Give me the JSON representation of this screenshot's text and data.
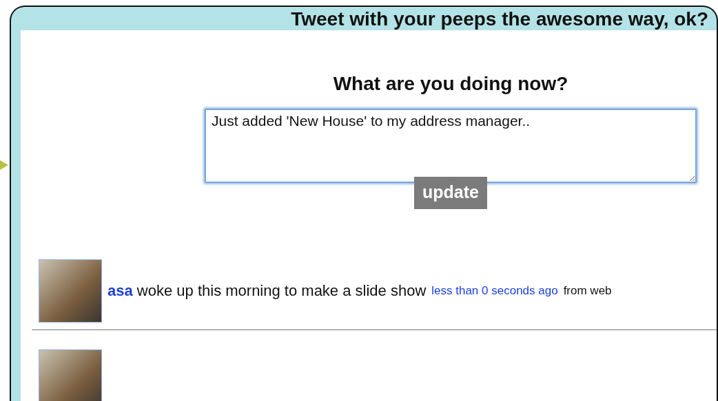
{
  "header": {
    "title": "Tweet with your peeps the awesome way, ok?"
  },
  "composer": {
    "heading": "What are you doing now?",
    "value": "Just added 'New House' to my address manager..",
    "button": "update"
  },
  "tweets": [
    {
      "kind": "full",
      "user": "asa",
      "text": "woke up this morning to make a slide show",
      "time": "less than 0 seconds ago",
      "source": "from web"
    },
    {
      "kind": "cut"
    }
  ]
}
